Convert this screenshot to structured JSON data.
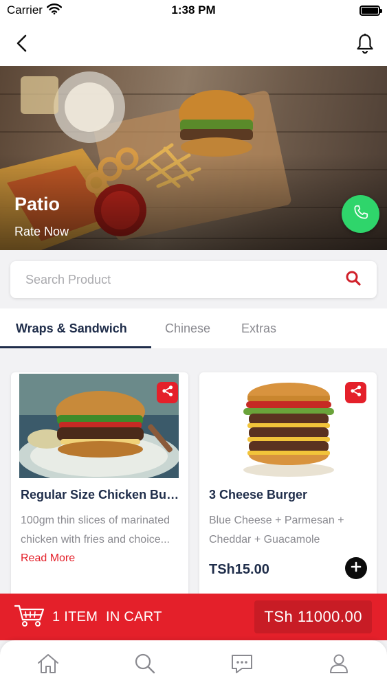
{
  "status_bar": {
    "carrier": "Carrier",
    "time": "1:38 PM"
  },
  "nav": {
    "back_icon": "chevron-left-icon",
    "notification_icon": "bell-icon"
  },
  "hero": {
    "title": "Patio",
    "rate_label": "Rate Now",
    "call_icon": "phone-icon",
    "call_color": "#2fd56b"
  },
  "search": {
    "placeholder": "Search Product",
    "icon": "search-icon"
  },
  "tabs": [
    {
      "label": "Wraps & Sandwich",
      "active": true
    },
    {
      "label": "Chinese",
      "active": false
    },
    {
      "label": "Extras",
      "active": false
    }
  ],
  "products": [
    {
      "title": "Regular Size Chicken Burger",
      "description": "100gm thin slices of marinated chicken with fries and choice...",
      "read_more": "Read More"
    },
    {
      "title": "3 Cheese Burger",
      "description": "Blue Cheese + Parmesan + Cheddar + Guacamole",
      "price": "TSh15.00"
    }
  ],
  "cart": {
    "label": "1 ITEM  IN CART",
    "total": "TSh 11000.00",
    "color": "#e4202a"
  },
  "bottom_nav": [
    {
      "icon": "home-icon"
    },
    {
      "icon": "search-icon"
    },
    {
      "icon": "chat-icon"
    },
    {
      "icon": "user-icon"
    }
  ]
}
